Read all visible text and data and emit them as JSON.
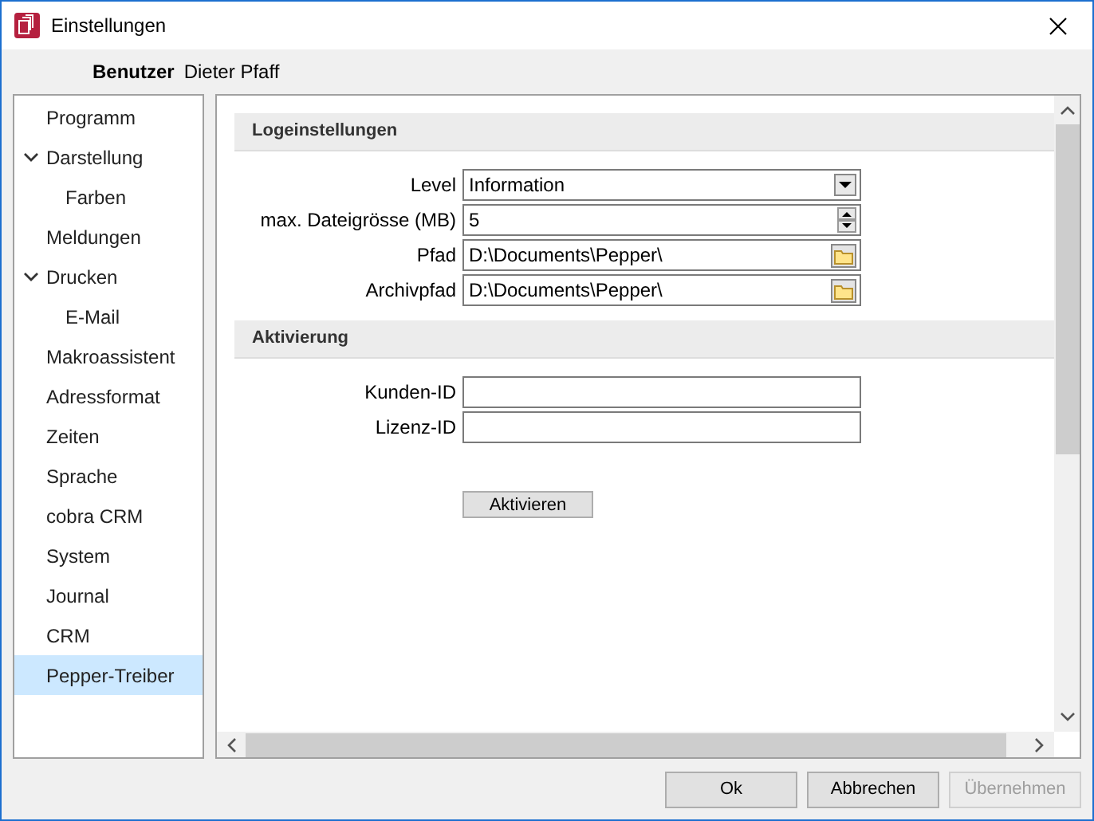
{
  "window": {
    "title": "Einstellungen"
  },
  "user": {
    "label": "Benutzer",
    "value": "Dieter Pfaff"
  },
  "sidebar": {
    "items": [
      {
        "label": "Programm",
        "selected": false
      },
      {
        "label": "Darstellung",
        "selected": false,
        "expanded": true,
        "children": [
          {
            "label": "Farben",
            "selected": false
          }
        ]
      },
      {
        "label": "Meldungen",
        "selected": false
      },
      {
        "label": "Drucken",
        "selected": false,
        "expanded": true,
        "children": [
          {
            "label": "E-Mail",
            "selected": false
          }
        ]
      },
      {
        "label": "Makroassistent",
        "selected": false
      },
      {
        "label": "Adressformat",
        "selected": false
      },
      {
        "label": "Zeiten",
        "selected": false
      },
      {
        "label": "Sprache",
        "selected": false
      },
      {
        "label": "cobra CRM",
        "selected": false
      },
      {
        "label": "System",
        "selected": false
      },
      {
        "label": "Journal",
        "selected": false
      },
      {
        "label": "CRM",
        "selected": false
      },
      {
        "label": "Pepper-Treiber",
        "selected": true
      }
    ]
  },
  "sections": [
    {
      "title": "Logeinstellungen",
      "fields": [
        {
          "kind": "select",
          "label": "Level",
          "value": "Information"
        },
        {
          "kind": "spinner",
          "label": "max. Dateigrösse (MB)",
          "value": "5"
        },
        {
          "kind": "path",
          "label": "Pfad",
          "value": "D:\\Documents\\Pepper\\"
        },
        {
          "kind": "path",
          "label": "Archivpfad",
          "value": "D:\\Documents\\Pepper\\"
        }
      ]
    },
    {
      "title": "Aktivierung",
      "fields": [
        {
          "kind": "text",
          "label": "Kunden-ID"
        },
        {
          "kind": "text",
          "label": "Lizenz-ID"
        }
      ],
      "button": "Aktivieren"
    }
  ],
  "buttons": [
    {
      "label": "Ok",
      "disabled": false
    },
    {
      "label": "Abbrechen",
      "disabled": false
    },
    {
      "label": "Übernehmen",
      "disabled": true
    }
  ]
}
